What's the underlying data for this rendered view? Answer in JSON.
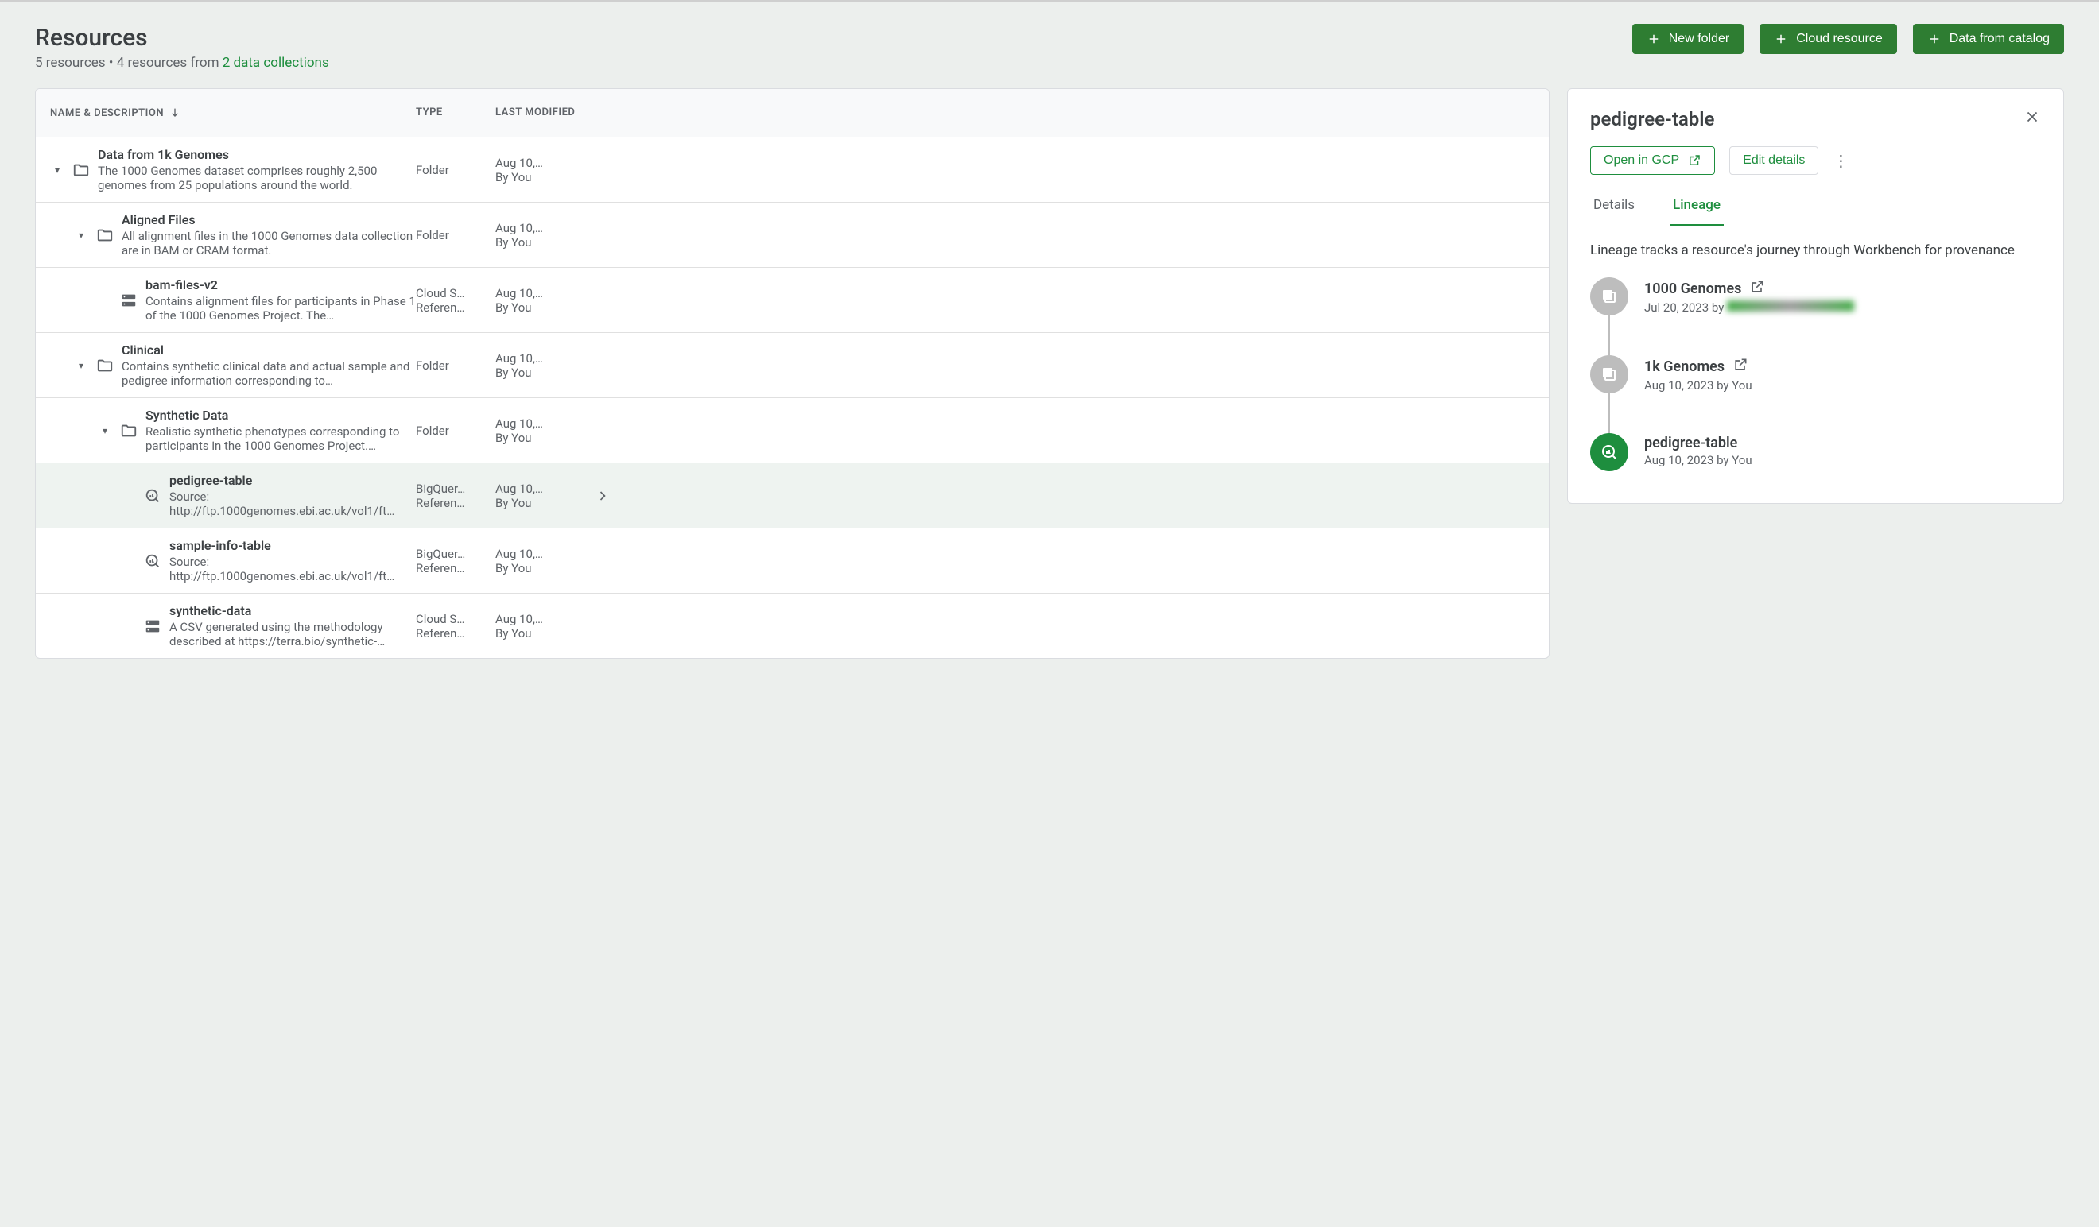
{
  "header": {
    "title": "Resources",
    "subtitle_prefix": "5 resources • 4 resources from ",
    "subtitle_link": "2 data collections"
  },
  "buttons": {
    "new_folder": "New folder",
    "cloud_resource": "Cloud resource",
    "data_from_catalog": "Data from catalog"
  },
  "table": {
    "headers": {
      "name": "NAME & DESCRIPTION",
      "type": "TYPE",
      "modified": "LAST MODIFIED"
    },
    "rows": [
      {
        "indent": 0,
        "expandable": true,
        "icon": "folder",
        "title": "Data from 1k Genomes",
        "desc": "The 1000 Genomes dataset comprises roughly 2,500 genomes from 25 populations around the world.",
        "type": "Folder",
        "mod_date": "Aug 10,…",
        "mod_by": "By You",
        "selected": false
      },
      {
        "indent": 1,
        "expandable": true,
        "icon": "folder",
        "title": "Aligned Files",
        "desc": "All alignment files in the 1000 Genomes data collection are in BAM or CRAM format.",
        "type": "Folder",
        "mod_date": "Aug 10,…",
        "mod_by": "By You",
        "selected": false
      },
      {
        "indent": 2,
        "expandable": false,
        "icon": "storage",
        "title": "bam-files-v2",
        "desc": "Contains alignment files for participants in Phase 1 of the 1000 Genomes Project. The…",
        "type": "Cloud S… Referen…",
        "mod_date": "Aug 10,…",
        "mod_by": "By You",
        "selected": false
      },
      {
        "indent": 1,
        "expandable": true,
        "icon": "folder",
        "title": "Clinical",
        "desc": "Contains synthetic clinical data and actual sample and pedigree information corresponding to…",
        "type": "Folder",
        "mod_date": "Aug 10,…",
        "mod_by": "By You",
        "selected": false
      },
      {
        "indent": 2,
        "expandable": true,
        "icon": "folder",
        "title": "Synthetic Data",
        "desc": "Realistic synthetic phenotypes corresponding to participants in the 1000 Genomes Project.…",
        "type": "Folder",
        "mod_date": "Aug 10,…",
        "mod_by": "By You",
        "selected": false
      },
      {
        "indent": 3,
        "expandable": false,
        "icon": "bigquery",
        "title": "pedigree-table",
        "desc": "Source: http://ftp.1000genomes.ebi.ac.uk/vol1/ft…",
        "type": "BigQuer… Referen…",
        "mod_date": "Aug 10,…",
        "mod_by": "By You",
        "selected": true,
        "show_chevron": true
      },
      {
        "indent": 3,
        "expandable": false,
        "icon": "bigquery",
        "title": "sample-info-table",
        "desc": "Source: http://ftp.1000genomes.ebi.ac.uk/vol1/ft…",
        "type": "BigQuer… Referen…",
        "mod_date": "Aug 10,…",
        "mod_by": "By You",
        "selected": false
      },
      {
        "indent": 3,
        "expandable": false,
        "icon": "storage",
        "title": "synthetic-data",
        "desc": "A CSV generated using the methodology described at https://terra.bio/synthetic-…",
        "type": "Cloud S… Referen…",
        "mod_date": "Aug 10,…",
        "mod_by": "By You",
        "selected": false
      }
    ]
  },
  "panel": {
    "title": "pedigree-table",
    "open_in_gcp": "Open in GCP",
    "edit_details": "Edit details",
    "tabs": {
      "details": "Details",
      "lineage": "Lineage"
    },
    "lineage_desc": "Lineage tracks a resource's journey through Workbench for provenance",
    "lineage": [
      {
        "icon": "collection",
        "color": "gray",
        "title": "1000 Genomes",
        "sub_prefix": "Jul 20, 2023 by ",
        "sub_redacted": true,
        "external": true
      },
      {
        "icon": "collection",
        "color": "gray",
        "title": "1k Genomes",
        "sub": "Aug 10, 2023 by You",
        "external": true
      },
      {
        "icon": "bigquery",
        "color": "green",
        "title": "pedigree-table",
        "sub": "Aug 10, 2023 by You",
        "external": false
      }
    ]
  }
}
